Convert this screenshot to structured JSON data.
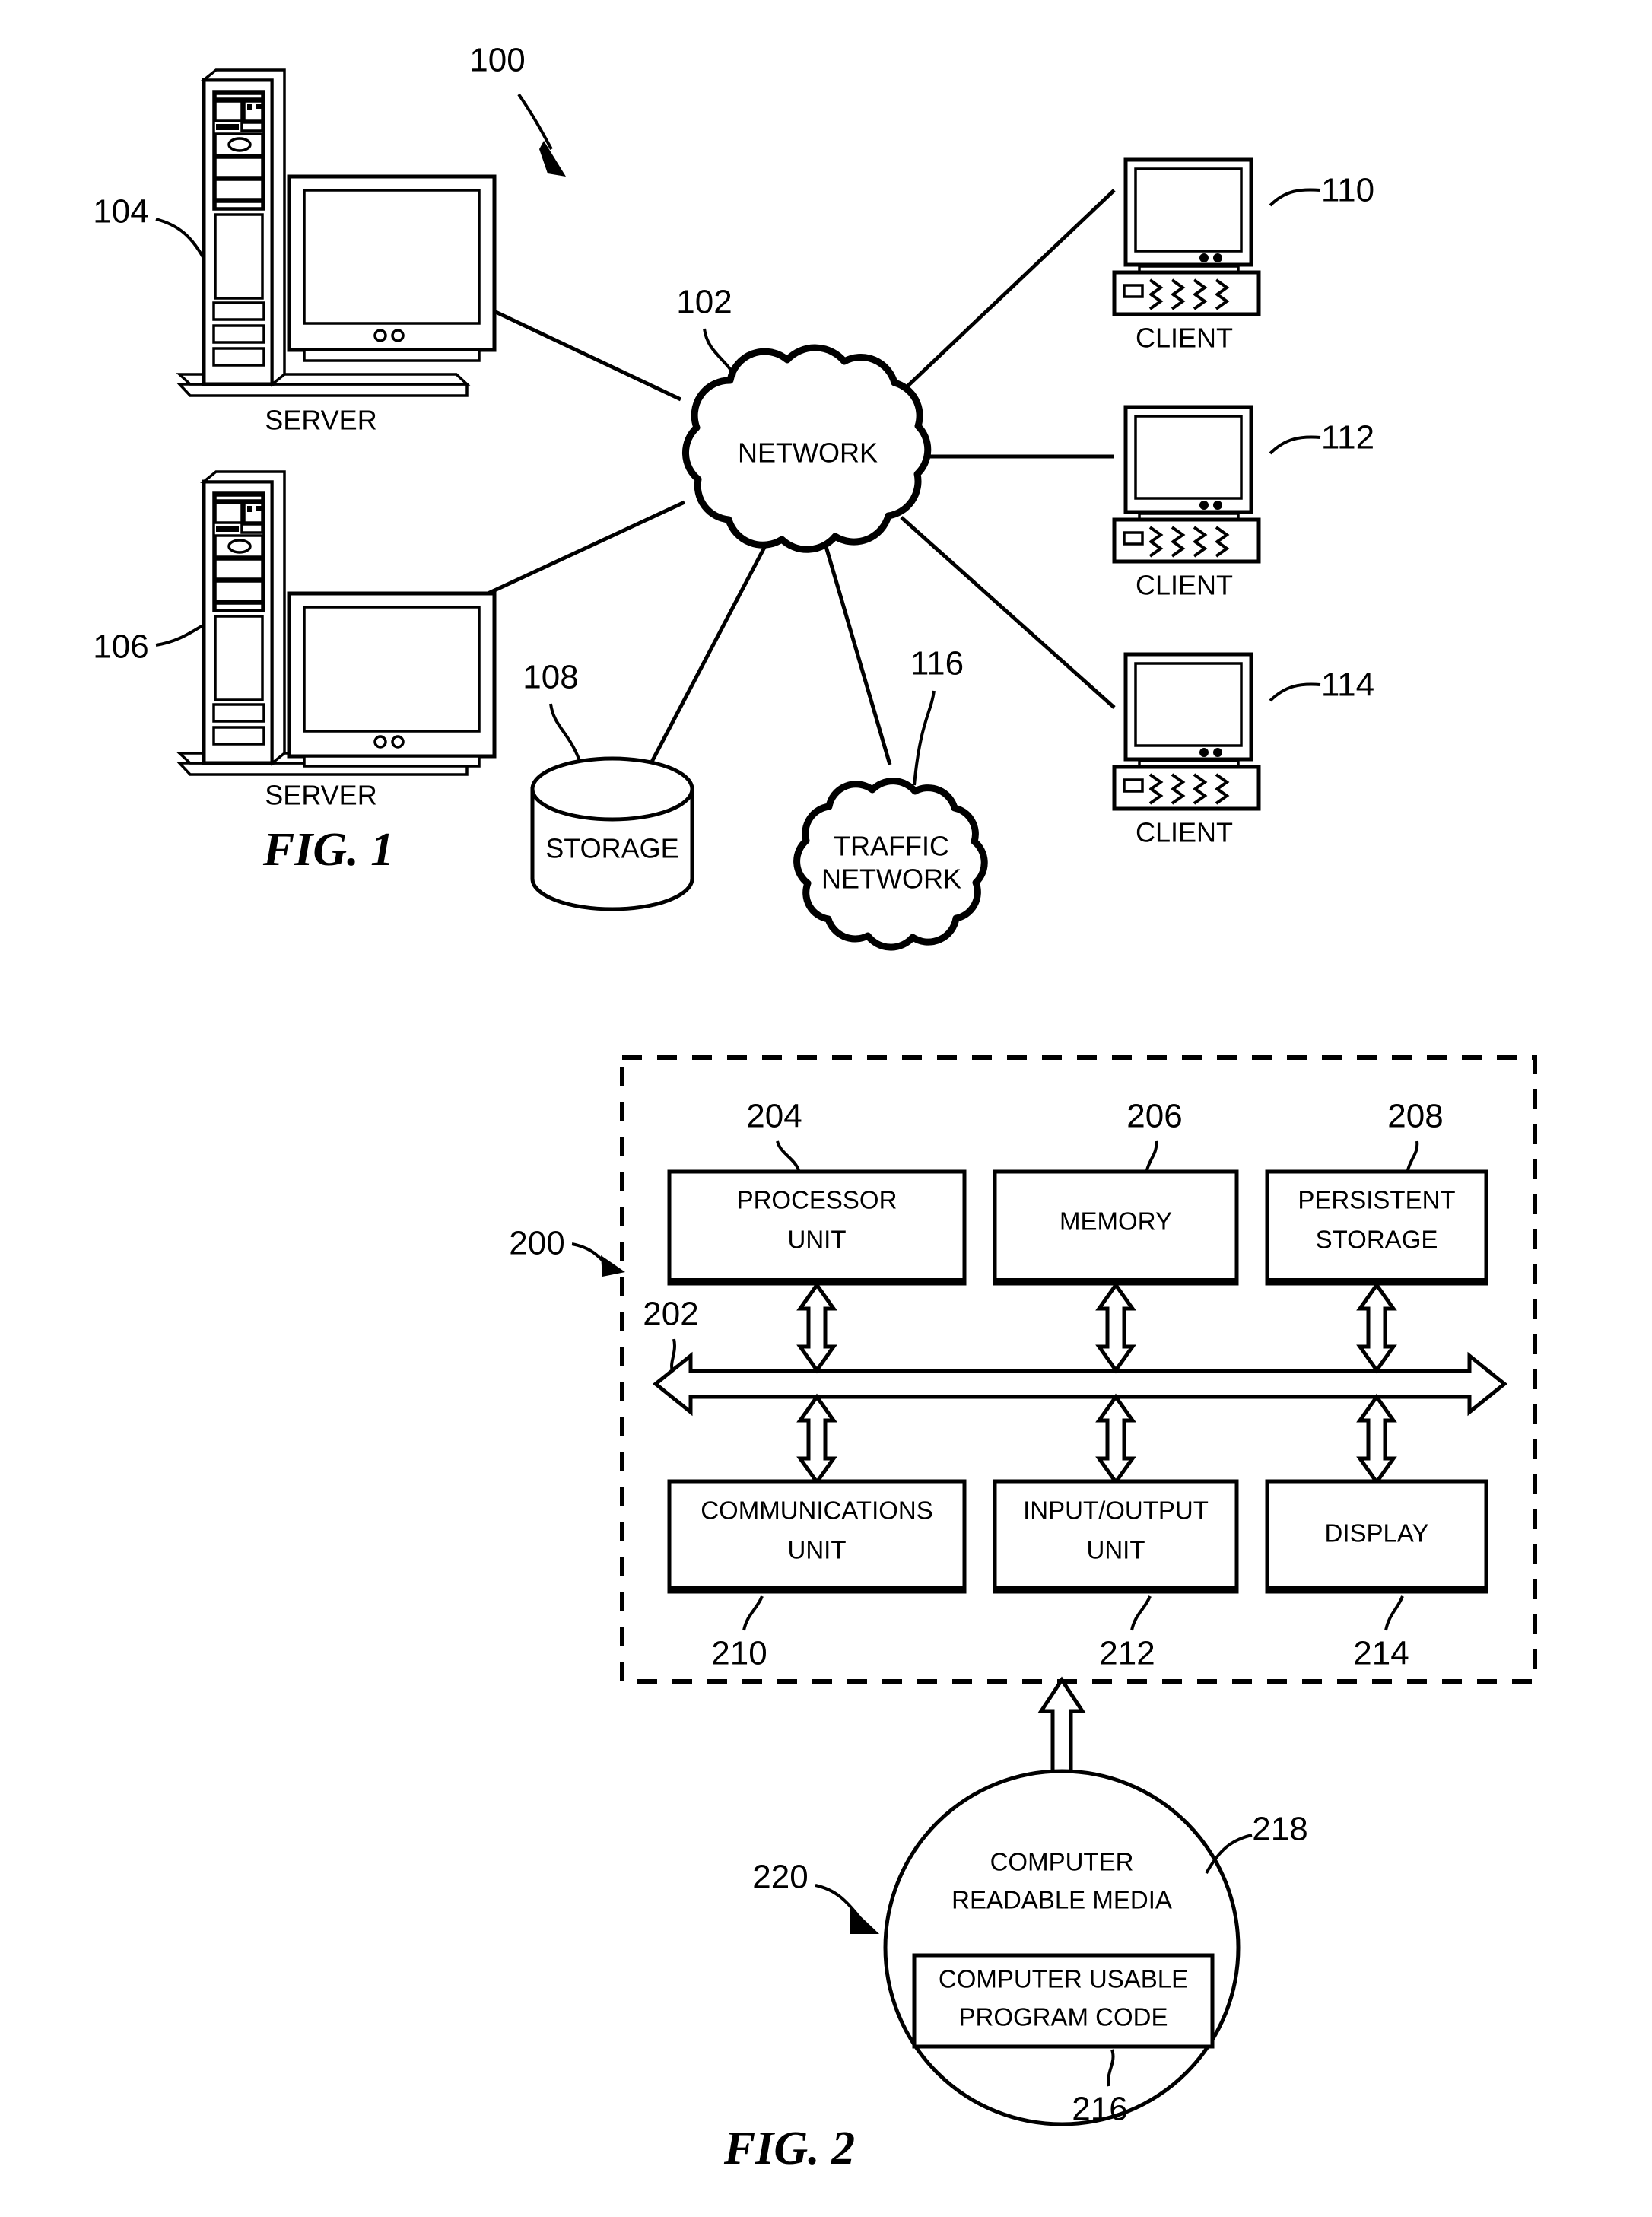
{
  "figure1": {
    "caption": "FIG. 1",
    "ref": "100",
    "network": {
      "label": "NETWORK",
      "ref": "102"
    },
    "traffic_network": {
      "label": "TRAFFIC",
      "label2": "NETWORK",
      "ref": "116"
    },
    "storage": {
      "label": "STORAGE",
      "ref": "108"
    },
    "servers": [
      {
        "label": "SERVER",
        "ref": "104"
      },
      {
        "label": "SERVER",
        "ref": "106"
      }
    ],
    "clients": [
      {
        "label": "CLIENT",
        "ref": "110"
      },
      {
        "label": "CLIENT",
        "ref": "112"
      },
      {
        "label": "CLIENT",
        "ref": "114"
      }
    ]
  },
  "figure2": {
    "caption": "FIG. 2",
    "data_processing_system_ref": "200",
    "bus_ref": "202",
    "top_boxes": [
      {
        "line1": "PROCESSOR",
        "line2": "UNIT",
        "ref": "204"
      },
      {
        "line1": "MEMORY",
        "line2": "",
        "ref": "206"
      },
      {
        "line1": "PERSISTENT",
        "line2": "STORAGE",
        "ref": "208"
      }
    ],
    "bottom_boxes": [
      {
        "line1": "COMMUNICATIONS",
        "line2": "UNIT",
        "ref": "210"
      },
      {
        "line1": "INPUT/OUTPUT",
        "line2": "UNIT",
        "ref": "212"
      },
      {
        "line1": "DISPLAY",
        "line2": "",
        "ref": "214"
      }
    ],
    "media": {
      "line1": "COMPUTER",
      "line2": "READABLE MEDIA",
      "ref": "218",
      "outer_ref": "220",
      "inner_box": {
        "line1": "COMPUTER USABLE",
        "line2": "PROGRAM CODE",
        "ref": "216"
      }
    }
  }
}
